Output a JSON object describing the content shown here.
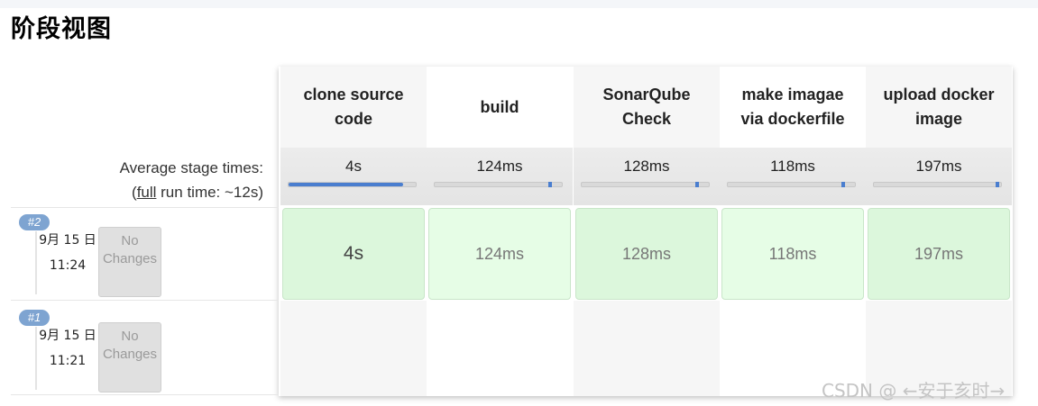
{
  "page": {
    "title": "阶段视图"
  },
  "averages": {
    "label_line1": "Average stage times:",
    "label_open": "(",
    "label_full_link": "full",
    "label_rest": " run time: ~12s)"
  },
  "stages": [
    {
      "name": "clone source code",
      "avg": "4s",
      "avg_fraction": 0.9,
      "color": "#dcf7dc"
    },
    {
      "name": "build",
      "avg": "124ms",
      "avg_fraction": 0.03,
      "color": "#e6fde6"
    },
    {
      "name": "SonarQube Check",
      "avg": "128ms",
      "avg_fraction": 0.03,
      "color": "#dcf7dc"
    },
    {
      "name": "make imagae via dockerfile",
      "avg": "118ms",
      "avg_fraction": 0.03,
      "color": "#e6fde6"
    },
    {
      "name": "upload docker image",
      "avg": "197ms",
      "avg_fraction": 0.04,
      "color": "#dcf7dc"
    }
  ],
  "runs": [
    {
      "badge": "#2",
      "date": "9月 15 日",
      "time": "11:24",
      "changes": "No Changes",
      "durations": [
        "4s",
        "124ms",
        "128ms",
        "118ms",
        "197ms"
      ]
    },
    {
      "badge": "#1",
      "date": "9月 15 日",
      "time": "11:21",
      "changes": "No Changes",
      "durations": []
    }
  ],
  "watermark": "CSDN @ ←安于亥时→"
}
